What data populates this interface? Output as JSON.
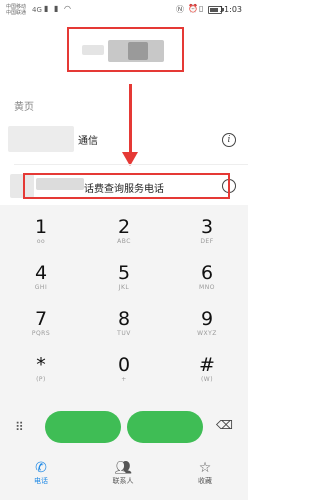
{
  "status_bar": {
    "carrier1": "中国移动",
    "carrier2": "中国联通",
    "signal": "4G",
    "time": "11:03",
    "battery_level": 0.8
  },
  "yellow_pages": {
    "section_label": "黄页",
    "items": [
      {
        "title_suffix": "通信"
      },
      {
        "title_suffix": "话费查询服务电话"
      }
    ]
  },
  "keypad": {
    "keys": [
      {
        "digit": "1",
        "letters": "oo"
      },
      {
        "digit": "2",
        "letters": "ABC"
      },
      {
        "digit": "3",
        "letters": "DEF"
      },
      {
        "digit": "4",
        "letters": "GHI"
      },
      {
        "digit": "5",
        "letters": "JKL"
      },
      {
        "digit": "6",
        "letters": "MNO"
      },
      {
        "digit": "7",
        "letters": "PQRS"
      },
      {
        "digit": "8",
        "letters": "TUV"
      },
      {
        "digit": "9",
        "letters": "WXYZ"
      },
      {
        "digit": "*",
        "letters": "(P)"
      },
      {
        "digit": "0",
        "letters": "+"
      },
      {
        "digit": "#",
        "letters": "(W)"
      }
    ],
    "delete_icon": "backspace-icon",
    "dialpad_icon": "dialpad-grid-icon",
    "call_color": "#3fbd55"
  },
  "bottom_nav": {
    "items": [
      {
        "label": "电话",
        "icon": "phone-icon"
      },
      {
        "label": "联系人",
        "icon": "contacts-icon"
      },
      {
        "label": "收藏",
        "icon": "star-icon"
      }
    ],
    "active_color": "#1e88e5"
  },
  "annotation_color": "#e53935"
}
